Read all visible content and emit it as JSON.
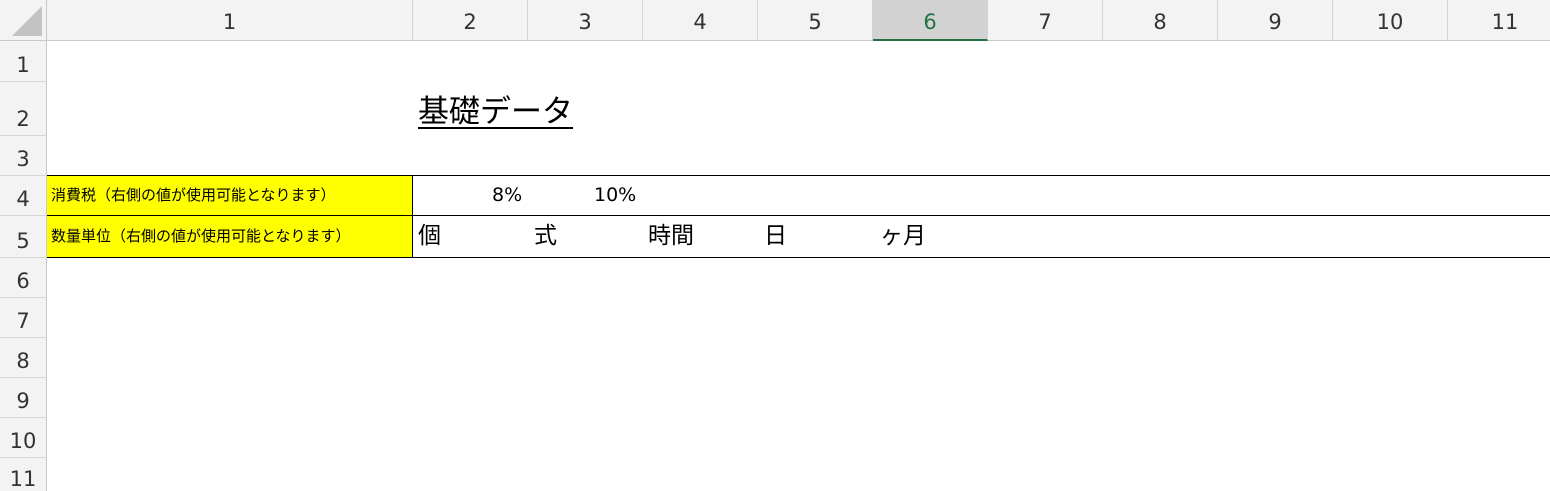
{
  "columns": [
    "1",
    "2",
    "3",
    "4",
    "5",
    "6",
    "7",
    "8",
    "9",
    "10",
    "11"
  ],
  "selected_column": "6",
  "rows": [
    "1",
    "2",
    "3",
    "4",
    "5",
    "6",
    "7",
    "8",
    "9",
    "10",
    "11"
  ],
  "sheet": {
    "title": "基礎データ",
    "tax_label": "消費税（右側の値が使用可能となります）",
    "tax_values": [
      "8%",
      "10%"
    ],
    "unit_label": "数量単位（右側の値が使用可能となります）",
    "unit_values": [
      "個",
      "式",
      "時間",
      "日",
      "ヶ月"
    ]
  },
  "colors": {
    "label_fill": "#ffff00",
    "selected_header_text": "#217346"
  }
}
